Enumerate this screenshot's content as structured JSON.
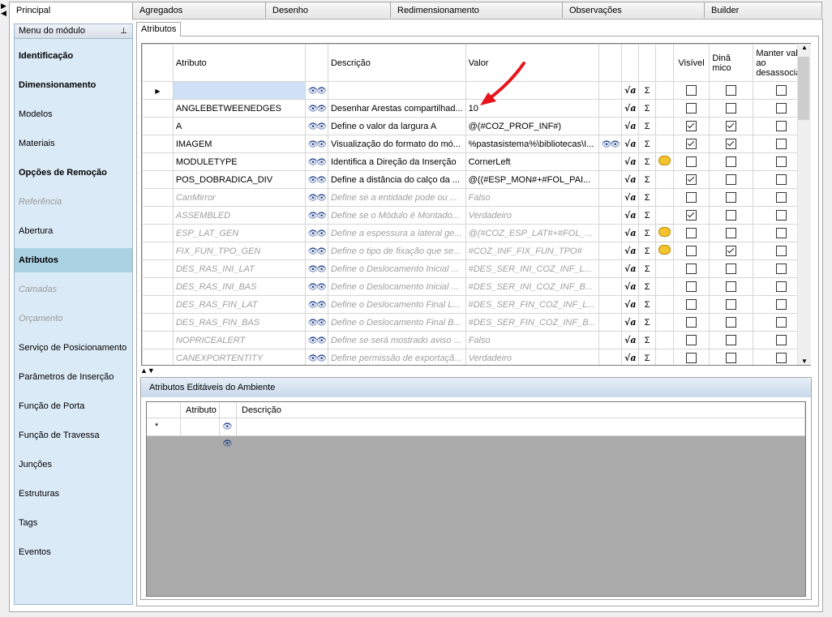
{
  "main_tabs": [
    "Principal",
    "Agregados",
    "Desenho",
    "Redimensionamento",
    "Observações",
    "Builder"
  ],
  "sidebar": {
    "title": "Menu do módulo",
    "items": [
      {
        "label": "Identificação",
        "style": "bold"
      },
      {
        "label": "Dimensionamento",
        "style": "bold"
      },
      {
        "label": "Modelos",
        "style": "normal"
      },
      {
        "label": "Materiais",
        "style": "normal"
      },
      {
        "label": "Opções de Remoção",
        "style": "bold"
      },
      {
        "label": "Referência",
        "style": "disabled"
      },
      {
        "label": "Abertura",
        "style": "normal"
      },
      {
        "label": "Atributos",
        "style": "selected"
      },
      {
        "label": "Camadas",
        "style": "disabled"
      },
      {
        "label": "Orçamento",
        "style": "disabled"
      },
      {
        "label": "Serviço de Posicionamento",
        "style": "normal"
      },
      {
        "label": "Parâmetros de Inserção",
        "style": "normal"
      },
      {
        "label": "Função de Porta",
        "style": "normal"
      },
      {
        "label": "Função de Travessa",
        "style": "normal"
      },
      {
        "label": "Junções",
        "style": "normal"
      },
      {
        "label": "Estruturas",
        "style": "normal"
      },
      {
        "label": "Tags",
        "style": "normal"
      },
      {
        "label": "Eventos",
        "style": "normal"
      }
    ]
  },
  "sub_tab": "Atributos",
  "grid": {
    "columns": {
      "atributo": "Atributo",
      "descricao": "Descrição",
      "valor": "Valor",
      "visivel": "Visível",
      "dinamico": "Dinâ mico",
      "manter": "Manter valor ao desassociar"
    },
    "sigma": "Σ",
    "sqrt": "√a",
    "rows": [
      {
        "attr": "",
        "desc": "",
        "val": "",
        "bino_val": false,
        "note": false,
        "vis": false,
        "din": false,
        "man": false,
        "disabled": false,
        "current": true
      },
      {
        "attr": "ANGLEBETWEENEDGES",
        "desc": "Desenhar Arestas compartilhad...",
        "val": "10",
        "bino_val": false,
        "note": false,
        "vis": false,
        "din": false,
        "man": false,
        "disabled": false
      },
      {
        "attr": "A",
        "desc": "Define o valor da largura A",
        "val": "@(#COZ_PROF_INF#)",
        "bino_val": false,
        "note": false,
        "vis": true,
        "din": true,
        "man": false,
        "disabled": false
      },
      {
        "attr": "IMAGEM",
        "desc": "Visualização do formato do mó...",
        "val": "%pastasistema%\\bibliotecas\\I...",
        "bino_val": true,
        "note": false,
        "vis": true,
        "din": true,
        "man": false,
        "disabled": false
      },
      {
        "attr": "MODULETYPE",
        "desc": "Identifica a Direção da Inserção",
        "val": "CornerLeft",
        "bino_val": false,
        "note": true,
        "vis": false,
        "din": false,
        "man": false,
        "disabled": false
      },
      {
        "attr": "POS_DOBRADICA_DIV",
        "desc": "Define a distância do calço da ...",
        "val": "@((#ESP_MON#+#FOL_PAI...",
        "bino_val": false,
        "note": false,
        "vis": true,
        "din": false,
        "man": false,
        "disabled": false
      },
      {
        "attr": "CanMirror",
        "desc": "Define se a entidade pode ou ...",
        "val": "Falso",
        "bino_val": false,
        "note": false,
        "vis": false,
        "din": false,
        "man": false,
        "disabled": true
      },
      {
        "attr": "ASSEMBLED",
        "desc": "Define se o Módulo é Montado...",
        "val": "Verdadeiro",
        "bino_val": false,
        "note": false,
        "vis": true,
        "din": false,
        "man": false,
        "disabled": true
      },
      {
        "attr": "ESP_LAT_GEN",
        "desc": "Define a espessura a lateral ge...",
        "val": "@(#COZ_ESP_LAT#+#FOL_...",
        "bino_val": false,
        "note": true,
        "vis": false,
        "din": false,
        "man": false,
        "disabled": true
      },
      {
        "attr": "FIX_FUN_TPO_GEN",
        "desc": "Define o tipo de fixação que se...",
        "val": "#COZ_INF_FIX_FUN_TPO#",
        "bino_val": false,
        "note": true,
        "vis": false,
        "din": true,
        "man": false,
        "disabled": true
      },
      {
        "attr": "DES_RAS_INI_LAT",
        "desc": "Define o Deslocamento Inicial ...",
        "val": "#DES_SER_INI_COZ_INF_L...",
        "bino_val": false,
        "note": false,
        "vis": false,
        "din": false,
        "man": false,
        "disabled": true
      },
      {
        "attr": "DES_RAS_INI_BAS",
        "desc": "Define o Deslocamento Inicial ...",
        "val": "#DES_SER_INI_COZ_INF_B...",
        "bino_val": false,
        "note": false,
        "vis": false,
        "din": false,
        "man": false,
        "disabled": true
      },
      {
        "attr": "DES_RAS_FIN_LAT",
        "desc": "Define o Deslocamento Final L...",
        "val": "#DES_SER_FIN_COZ_INF_L...",
        "bino_val": false,
        "note": false,
        "vis": false,
        "din": false,
        "man": false,
        "disabled": true
      },
      {
        "attr": "DES_RAS_FIN_BAS",
        "desc": "Define o Deslocamento Final B...",
        "val": "#DES_SER_FIN_COZ_INF_B...",
        "bino_val": false,
        "note": false,
        "vis": false,
        "din": false,
        "man": false,
        "disabled": true
      },
      {
        "attr": "NOPRICEALERT",
        "desc": "Define se será mostrado aviso ...",
        "val": "Falso",
        "bino_val": false,
        "note": false,
        "vis": false,
        "din": false,
        "man": false,
        "disabled": true
      },
      {
        "attr": "CANEXPORTENTITY",
        "desc": "Define permissão de exportaçã...",
        "val": "Verdadeiro",
        "bino_val": false,
        "note": false,
        "vis": false,
        "din": false,
        "man": false,
        "disabled": true
      }
    ]
  },
  "lower_panel": {
    "title": "Atributos Editáveis do Ambiente",
    "columns": {
      "atributo": "Atributo",
      "descricao": "Descrição"
    },
    "new_row_marker": "*"
  },
  "icons": {
    "binoculars": "binoculars-icon",
    "sqrt": "formula-icon",
    "sigma": "sigma-icon",
    "note": "comment-icon"
  },
  "colors": {
    "selected_menu": "#aad2e3",
    "sidebar_bg": "#dbeaf7",
    "arrow": "#e8141c",
    "disabled_text": "#a0a0a0",
    "grid_empty_area": "#aaaaaa"
  }
}
